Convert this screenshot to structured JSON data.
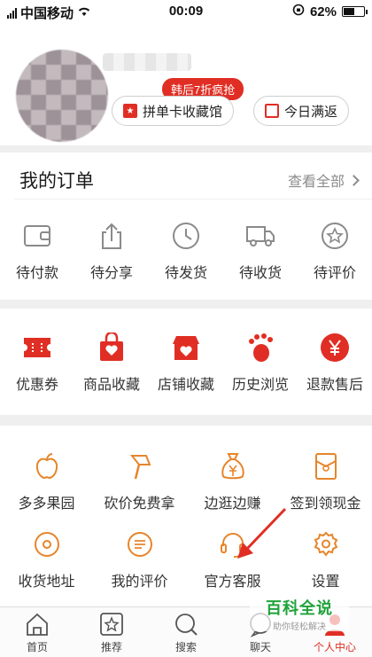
{
  "status": {
    "carrier": "中国移动",
    "time": "00:09",
    "battery": "62%",
    "battery_level": 0.62
  },
  "profile": {
    "promo_tag": "韩后7折疯抢",
    "pill_collect": "拼单卡收藏馆",
    "pill_daily": "今日满返"
  },
  "orders": {
    "title": "我的订单",
    "view_all": "查看全部",
    "items": [
      {
        "label": "待付款",
        "icon": "wallet-icon"
      },
      {
        "label": "待分享",
        "icon": "share-icon"
      },
      {
        "label": "待发货",
        "icon": "clock-icon"
      },
      {
        "label": "待收货",
        "icon": "truck-icon"
      },
      {
        "label": "待评价",
        "icon": "review-icon"
      }
    ]
  },
  "shortcuts": {
    "items": [
      {
        "label": "优惠券",
        "icon": "coupon-icon"
      },
      {
        "label": "商品收藏",
        "icon": "bag-heart-icon"
      },
      {
        "label": "店铺收藏",
        "icon": "store-heart-icon"
      },
      {
        "label": "历史浏览",
        "icon": "footprint-icon"
      },
      {
        "label": "退款售后",
        "icon": "yen-icon"
      }
    ]
  },
  "services": {
    "row1": [
      {
        "label": "多多果园",
        "icon": "apple-icon"
      },
      {
        "label": "砍价免费拿",
        "icon": "axe-icon"
      },
      {
        "label": "边逛边赚",
        "icon": "money-bag-icon"
      },
      {
        "label": "签到领现金",
        "icon": "red-envelope-icon"
      }
    ],
    "row2": [
      {
        "label": "收货地址",
        "icon": "location-icon"
      },
      {
        "label": "我的评价",
        "icon": "comment-icon"
      },
      {
        "label": "官方客服",
        "icon": "headset-icon"
      },
      {
        "label": "设置",
        "icon": "gear-icon"
      }
    ]
  },
  "nav": {
    "items": [
      {
        "label": "首页",
        "icon": "home-icon"
      },
      {
        "label": "推荐",
        "icon": "star-tag-icon"
      },
      {
        "label": "搜索",
        "icon": "search-icon"
      },
      {
        "label": "聊天",
        "icon": "chat-icon"
      },
      {
        "label": "个人中心",
        "icon": "person-icon"
      }
    ]
  },
  "watermark": {
    "main": "百科全说",
    "sub": "助你轻松解决"
  },
  "colors": {
    "accent": "#e02e24",
    "service_orange": "#e6852a",
    "icon_gray": "#8a8a8a"
  }
}
